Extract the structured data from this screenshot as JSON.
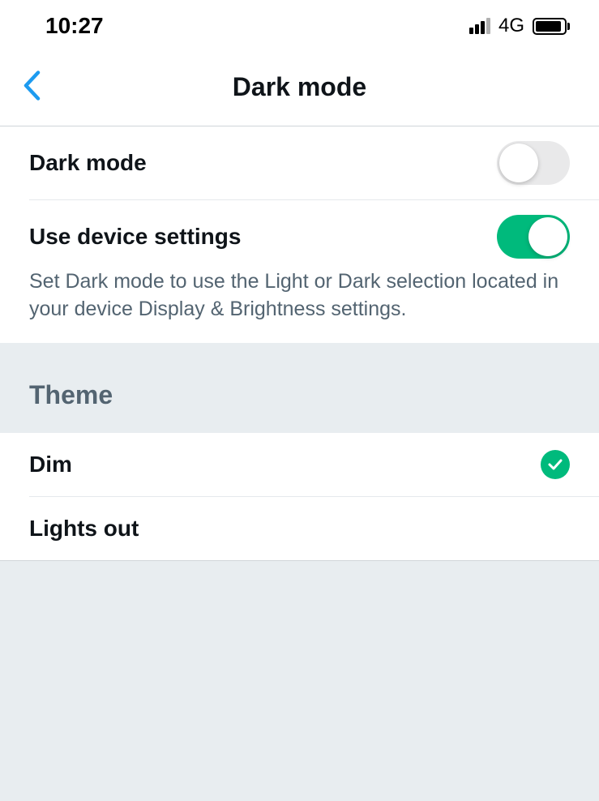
{
  "statusBar": {
    "time": "10:27",
    "network": "4G"
  },
  "header": {
    "title": "Dark mode"
  },
  "settings": {
    "darkMode": {
      "label": "Dark mode",
      "enabled": false
    },
    "useDevice": {
      "label": "Use device settings",
      "enabled": true,
      "help": "Set Dark mode to use the Light or Dark selection located in your device Display & Brightness settings."
    }
  },
  "theme": {
    "sectionTitle": "Theme",
    "options": [
      {
        "label": "Dim",
        "selected": true
      },
      {
        "label": "Lights out",
        "selected": false
      }
    ]
  },
  "colors": {
    "accent": "#00ba7c",
    "link": "#1d9bf0",
    "muted": "#536471"
  }
}
